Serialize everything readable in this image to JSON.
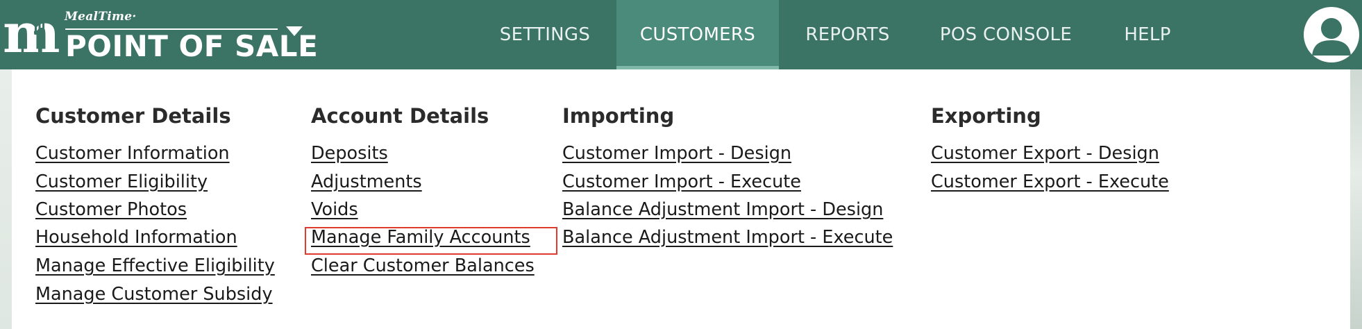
{
  "brand": {
    "small": "MealTime·",
    "big": "POINT OF SALE"
  },
  "nav": {
    "items": [
      {
        "label": "SETTINGS"
      },
      {
        "label": "CUSTOMERS"
      },
      {
        "label": "REPORTS"
      },
      {
        "label": "POS CONSOLE"
      },
      {
        "label": "HELP"
      }
    ],
    "active": "CUSTOMERS"
  },
  "menu": {
    "columns": [
      {
        "heading": "Customer Details",
        "links": [
          "Customer Information",
          "Customer Eligibility",
          "Customer Photos",
          "Household Information",
          "Manage Effective Eligibility",
          "Manage Customer Subsidy"
        ]
      },
      {
        "heading": "Account Details",
        "links": [
          "Deposits",
          "Adjustments",
          "Voids",
          "Manage Family Accounts",
          "Clear Customer Balances"
        ]
      },
      {
        "heading": "Importing",
        "links": [
          "Customer Import - Design",
          "Customer Import - Execute",
          "Balance Adjustment Import - Design",
          "Balance Adjustment Import - Execute"
        ]
      },
      {
        "heading": "Exporting",
        "links": [
          "Customer Export - Design",
          "Customer Export - Execute"
        ]
      }
    ],
    "highlighted_link": "Manage Family Accounts"
  },
  "colors": {
    "header_bg": "#3b7364",
    "active_tab_bg": "#4b8b7b",
    "highlight_border": "#e03a2f"
  },
  "icons": [
    "mealtime-logo-icon",
    "chevron-down-icon",
    "user-avatar-icon"
  ]
}
